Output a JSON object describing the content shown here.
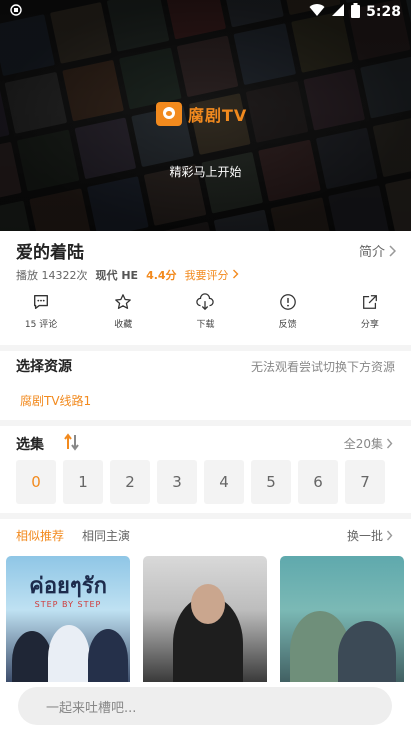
{
  "status_bar": {
    "time": "5:28"
  },
  "player": {
    "brand": "腐剧TV",
    "caption": "精彩马上开始"
  },
  "show": {
    "title": "爱的着陆",
    "intro_label": "简介",
    "plays": "播放 14322次",
    "type": "现代 HE",
    "score": "4.4分",
    "rate_label": "我要评分"
  },
  "actions": [
    {
      "label": "15 评论",
      "icon": "comment-icon"
    },
    {
      "label": "收藏",
      "icon": "star-icon"
    },
    {
      "label": "下载",
      "icon": "download-icon"
    },
    {
      "label": "反馈",
      "icon": "feedback-icon"
    },
    {
      "label": "分享",
      "icon": "share-icon"
    }
  ],
  "source": {
    "title": "选择资源",
    "note": "无法观看尝试切换下方资源",
    "line": "腐剧TV线路1"
  },
  "episodes": {
    "title": "选集",
    "all_label": "全20集",
    "items": [
      "0",
      "1",
      "2",
      "3",
      "4",
      "5",
      "6",
      "7"
    ]
  },
  "recommend": {
    "tabs": [
      "相似推荐",
      "相同主演"
    ],
    "refresh_label": "换一批",
    "poster1_title": "ค่อยๆรัก",
    "poster1_sub": "STEP BY STEP"
  },
  "comment": {
    "placeholder": "一起来吐槽吧..."
  },
  "colors": {
    "accent": "#f28a1e"
  }
}
